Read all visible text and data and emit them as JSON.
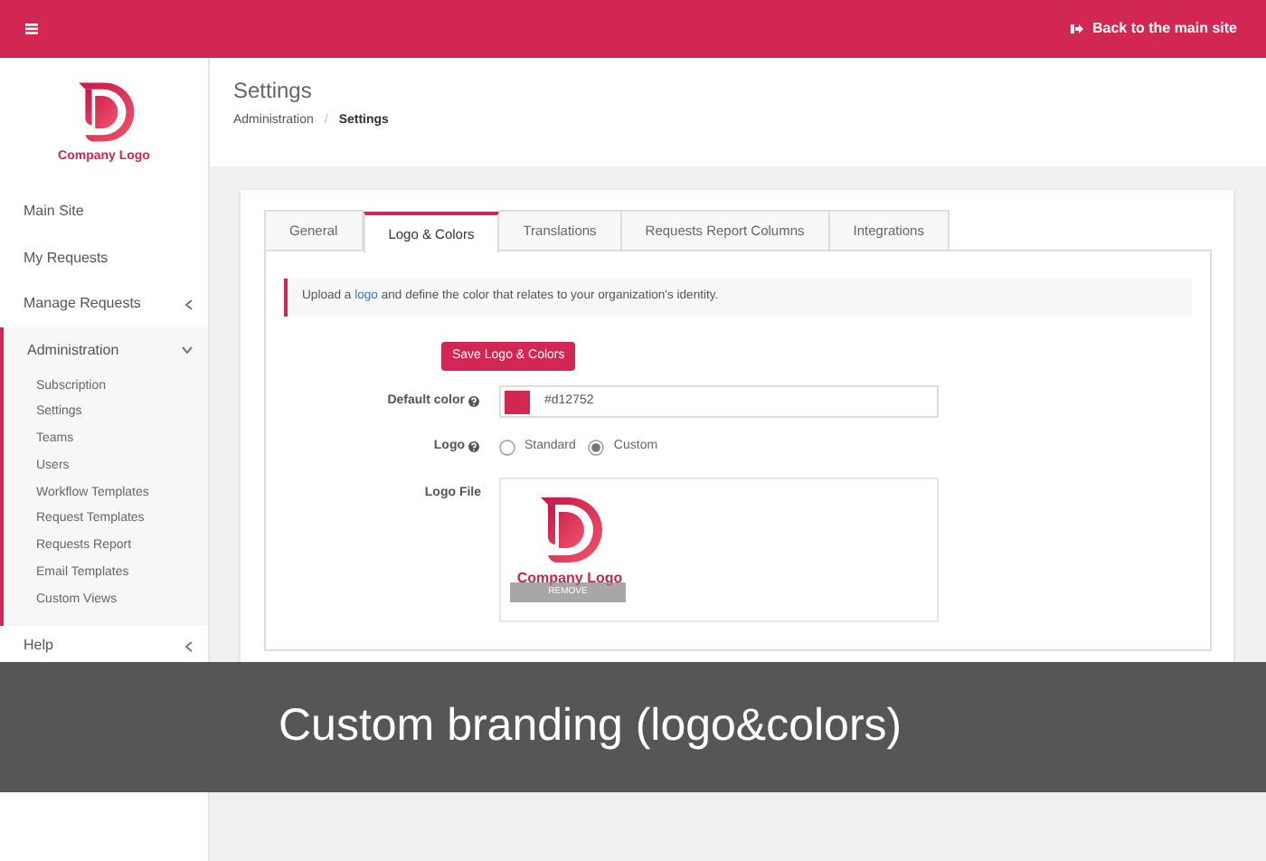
{
  "topbar": {
    "back_link": "Back to the main site"
  },
  "sidebar": {
    "logo_text": "Company Logo",
    "items": [
      {
        "label": "Main Site",
        "kind": "link"
      },
      {
        "label": "My Requests",
        "kind": "link"
      },
      {
        "label": "Manage Requests",
        "kind": "group",
        "expanded": false
      },
      {
        "label": "Administration",
        "kind": "group",
        "expanded": true,
        "children": [
          {
            "label": "Subscription"
          },
          {
            "label": "Settings"
          },
          {
            "label": "Teams"
          },
          {
            "label": "Users"
          },
          {
            "label": "Workflow Templates"
          },
          {
            "label": "Request Templates"
          },
          {
            "label": "Requests Report"
          },
          {
            "label": "Email Templates"
          },
          {
            "label": "Custom Views"
          }
        ]
      },
      {
        "label": "Help",
        "kind": "group",
        "expanded": false
      }
    ]
  },
  "page": {
    "title": "Settings",
    "breadcrumb": [
      "Administration",
      "Settings"
    ],
    "breadcrumb_separator": "/"
  },
  "tabs": [
    {
      "label": "General",
      "selected": false
    },
    {
      "label": "Logo & Colors",
      "selected": true
    },
    {
      "label": "Translations",
      "selected": false
    },
    {
      "label": "Requests Report Columns",
      "selected": false
    },
    {
      "label": "Integrations",
      "selected": false
    }
  ],
  "notice": {
    "before": "Upload a ",
    "link": "logo",
    "after": " and define the color that relates to your organization's identity."
  },
  "save_button": "Save Logo & Colors",
  "form": {
    "color_label": "Default color",
    "color_value": "#d12752",
    "logo_label": "Logo",
    "logo_options": [
      {
        "label": "Standard",
        "selected": false
      },
      {
        "label": "Custom",
        "selected": true
      }
    ],
    "file_label": "Logo File",
    "preview_text": "Company Logo",
    "remove_button": "REMOVE"
  },
  "caption": "Custom branding (logo&colors)"
}
